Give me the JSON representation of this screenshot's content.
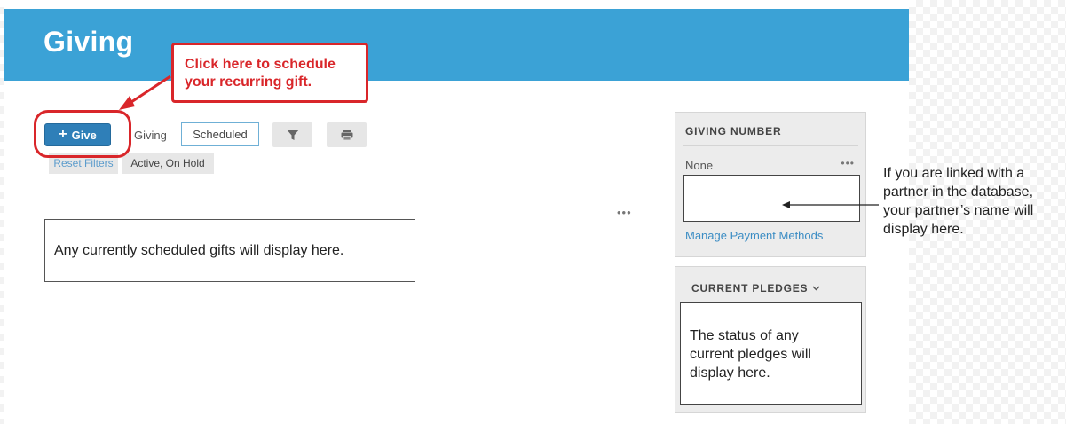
{
  "header": {
    "title": "Giving"
  },
  "toolbar": {
    "give_label": "Give",
    "tabs": [
      {
        "label": "Giving"
      },
      {
        "label": "Scheduled"
      }
    ],
    "filter_icon": "filter-icon",
    "print_icon": "print-icon"
  },
  "filters": {
    "reset_label": "Reset Filters",
    "active_label": "Active, On Hold"
  },
  "main": {
    "scheduled_note": "Any currently scheduled gifts will display here."
  },
  "callout": {
    "line1": "Click here to schedule",
    "line2": "your recurring gift."
  },
  "sidebar": {
    "giving_number": {
      "heading": "GIVING NUMBER",
      "value": "None",
      "manage_label": "Manage Payment Methods"
    },
    "pledges": {
      "heading": "CURRENT PLEDGES",
      "note_line1": "The status of any",
      "note_line2": "current pledges will",
      "note_line3": "display here."
    }
  },
  "right_note": {
    "line1": "If you are linked with a",
    "line2": "partner in the database,",
    "line3": "your partner’s name will",
    "line4": "display here."
  },
  "colors": {
    "header": "#3ba2d6",
    "give_button": "#2f7fb8",
    "annotation": "#d9262a",
    "link": "#3c8dc4"
  }
}
